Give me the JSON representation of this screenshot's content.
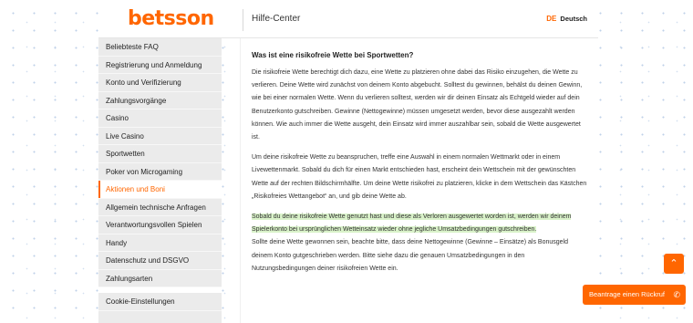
{
  "header": {
    "logo": "betsson",
    "help_center": "Hilfe-Center",
    "lang_code": "DE",
    "lang_name": "Deutsch"
  },
  "sidebar": {
    "items": [
      {
        "label": "Beliebteste FAQ",
        "active": false
      },
      {
        "label": "Registrierung und Anmeldung",
        "active": false
      },
      {
        "label": "Konto und Verifizierung",
        "active": false
      },
      {
        "label": "Zahlungsvorgänge",
        "active": false
      },
      {
        "label": "Casino",
        "active": false
      },
      {
        "label": "Live Casino",
        "active": false
      },
      {
        "label": "Sportwetten",
        "active": false
      },
      {
        "label": "Poker von Microgaming",
        "active": false
      },
      {
        "label": "Aktionen und Boni",
        "active": true
      },
      {
        "label": "Allgemein technische Anfragen",
        "active": false
      },
      {
        "label": "Verantwortungsvollen Spielen",
        "active": false
      },
      {
        "label": "Handy",
        "active": false
      },
      {
        "label": "Datenschutz und DSGVO",
        "active": false
      },
      {
        "label": "Zahlungsarten",
        "active": false
      }
    ],
    "footer_item": "Cookie-Einstellungen"
  },
  "article": {
    "title": "Was ist eine risikofreie Wette bei Sportwetten?",
    "p1": "Die risikofreie Wette berechtigt dich dazu, eine Wette zu platzieren ohne dabei das Risiko einzugehen, die Wette zu verlieren. Deine Wette wird zunächst von deinem Konto abgebucht. Solltest du gewinnen, behälst du deinen Gewinn, wie bei einer normalen Wette. Wenn du verlieren solltest, werden wir dir deinen Einsatz als Echtgeld wieder auf dein Benutzerkonto gutschreiben. Gewinne (Nettogewinne) müssen umgesetzt werden, bevor diese ausgezahlt werden können. Wie auch immer die Wette ausgeht, dein Einsatz wird immer auszahlbar sein, sobald die Wette ausgewertet ist.",
    "p2": "Um deine risikofreie Wette zu beanspruchen, treffe eine Auswahl in einem normalen Wettmarkt oder in einem Livewettenmarkt. Sobald du dich für einen Markt entschieden hast, erscheint dein Wettschein mit der gewünschten Wette auf der rechten Bildschirmhälfte. Um deine Wette risikofrei zu platzieren, klicke in dem Wettschein das Kästchen „Risikofreies Wettangebot“ an, und gib deine Wette ab.",
    "p3_highlight": "Sobald du deine risikofreie Wette genutzt hast und diese als Verloren ausgewertet worden ist, werden wir deinem Spielerkonto bei ursprünglichen Wetteinsatz wieder ohne jegliche Umsatzbedingungen gutschreiben.",
    "p4": "Sollte deine Wette gewonnen sein, beachte bitte, dass deine Nettogewinne (Gewinne – Einsätze) als Bonusgeld deinem Konto gutgeschrieben werden. Bitte siehe dazu die genauen Umsatzbedingungen in den Nutzungsbedingungen deiner risikofreien Wette ein."
  },
  "floating": {
    "scroll_top_icon": "chevron-up-icon",
    "scroll_top_glyph": "⌃",
    "callback_label": "Beantrage einen Rückruf",
    "callback_icon": "phone-icon",
    "callback_glyph": "✆"
  },
  "colors": {
    "accent": "#ff6600",
    "highlight": "#d9f2c9",
    "sidebar_bg": "#ebebeb"
  }
}
